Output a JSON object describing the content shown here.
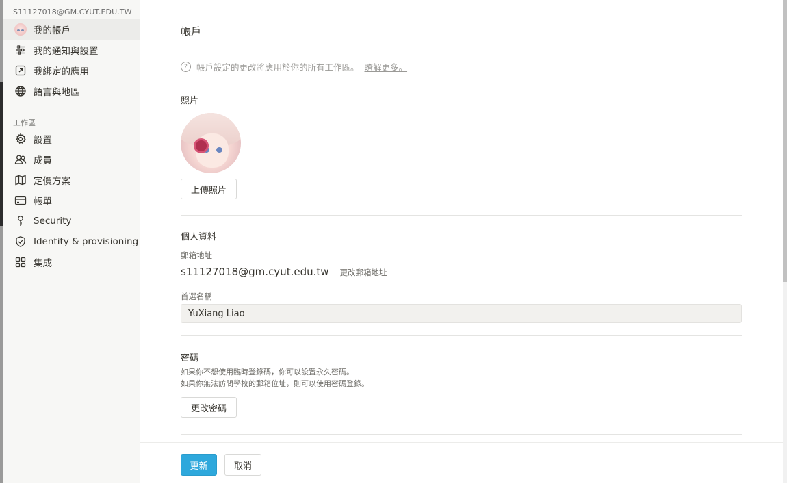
{
  "sidebar": {
    "email": "S11127018@GM.CYUT.EDU.TW",
    "account_items": [
      {
        "label": "我的帳戶",
        "icon": "avatar-icon"
      },
      {
        "label": "我的通知與設置",
        "icon": "sliders-icon"
      },
      {
        "label": "我綁定的應用",
        "icon": "external-link-icon"
      },
      {
        "label": "語言與地區",
        "icon": "globe-icon"
      }
    ],
    "workspace_label": "工作區",
    "workspace_items": [
      {
        "label": "設置",
        "icon": "gear-icon"
      },
      {
        "label": "成員",
        "icon": "people-icon"
      },
      {
        "label": "定價方案",
        "icon": "map-icon"
      },
      {
        "label": "帳單",
        "icon": "credit-card-icon"
      },
      {
        "label": "Security",
        "icon": "key-icon"
      },
      {
        "label": "Identity & provisioning",
        "icon": "shield-check-icon"
      },
      {
        "label": "集成",
        "icon": "grid-icon"
      }
    ]
  },
  "main": {
    "title": "帳戶",
    "note": "帳戶設定的更改將應用於你的所有工作區。",
    "note_link": "瞭解更多。",
    "photo_heading": "照片",
    "upload_button": "上傳照片",
    "profile_heading": "個人資料",
    "email_label": "郵箱地址",
    "email_value": "s11127018@gm.cyut.edu.tw",
    "change_email": "更改郵箱地址",
    "name_label": "首選名稱",
    "name_value": "YuXiang Liao",
    "password_heading": "密碼",
    "password_desc_1": "如果你不想使用臨時登錄碼，你可以設置永久密碼。",
    "password_desc_2": "如果你無法訪問學校的郵箱位址，則可以使用密碼登錄。",
    "change_password_button": "更改密碼"
  },
  "footer": {
    "update_button": "更新",
    "cancel_button": "取消"
  },
  "colors": {
    "primary": "#2ea8dc",
    "sidebar_bg": "#f7f7f5",
    "active_item_bg": "#ececea"
  }
}
